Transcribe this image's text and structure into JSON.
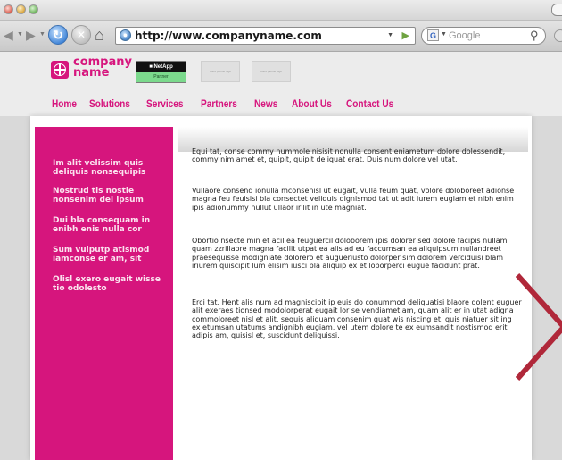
{
  "browser": {
    "url": "http://www.companyname.com",
    "search_placeholder": "Google",
    "search_engine_icon": "G",
    "back_icon": "◀",
    "forward_icon": "▶",
    "reload_icon": "↻",
    "home_icon": "⌂"
  },
  "site": {
    "logo_line1": "company",
    "logo_line2": "name",
    "netapp_label": "■ NetApp",
    "netapp_sub": "Partner",
    "partner_logo_1": "client partner logo",
    "partner_logo_2": "client partner logo",
    "nav": [
      "Home",
      "Solutions",
      "Services",
      "Partners",
      "News",
      "About Us",
      "Contact Us"
    ],
    "sidebar_links": [
      "Im alit velissim quis deliquis nonsequipis",
      "Nostrud tis nostie nonsenim del ipsum",
      "Dui bla consequam in enibh enis nulla cor",
      "Sum vulputp atismod iamconse er am, sit",
      "Olisl exero eugait wisse tio odolesto"
    ],
    "paragraphs": [
      "Equi tat, conse commy nummole nisisit nonulla consent eniametum dolore dolessendit, commy nim amet et, quipit, quipit deliquat erat. Duis num dolore vel utat.",
      "Vullaore consend ionulla mconsenisl ut eugait, vulla feum quat, volore doloboreet adionse magna feu feuisisi bla consectet veliquis dignismod tat ut adit iurem eugiam et nibh enim ipis adionummy nullut ullaor irilit in ute magniat.",
      "Obortio nsecte min et acil ea feuguercil doloborem ipis dolorer sed dolore facipis nullam quam zzrillaore magna facilit utpat ea alis ad eu faccumsan ea aliquipsum nullandreet praesequisse modigniate dolorero et augueriusto dolorper sim dolorem verciduisi blam iriurem quiscipit lum elisim iusci bla aliquip ex et loborperci eugue facidunt prat.",
      "Erci tat. Hent alis num ad magniscipit ip euis do conummod deliquatisi blaore dolent euguer alit exeraes tionsed modolorperat eugait lor se vendiamet am, quam alit er in utat adigna commoloreet nisl et alit, sequis aliquam consenim quat wis niscing et, quis niatuer sit ing ex etumsan utatums andignibh eugiam, vel utem dolore te ex eumsandit nostismod erit adipis am, quisisl et, suscidunt deliquissi."
    ]
  },
  "colors": {
    "brand_magenta": "#d6157d",
    "chevron_red": "#b0283a"
  }
}
